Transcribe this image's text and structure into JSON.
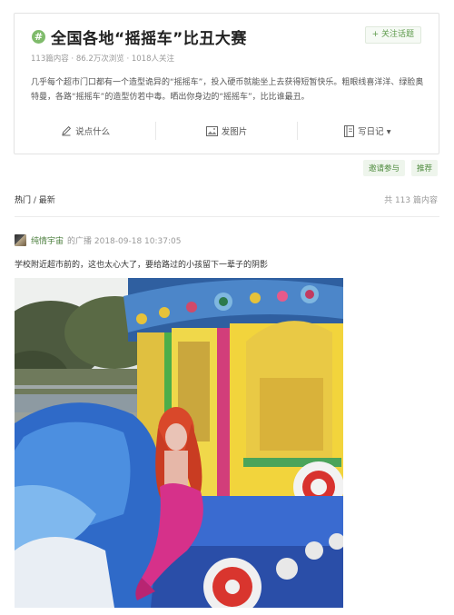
{
  "topic": {
    "hash_symbol": "#",
    "title": "全国各地“摇摇车”比丑大赛",
    "follow_label": "+ 关注话题",
    "stats": "113篇内容 · 86.2万次浏览 · 1018人关注",
    "description": "几乎每个超市门口都有一个造型诡异的“摇摇车”，投入硬币就能坐上去获得短暂快乐。粗眼线喜洋洋、绿脸奥特曼，各路“摇摇车”的造型仿若中毒。晒出你身边的“摇摇车”，比比谁最丑。"
  },
  "actions": [
    {
      "label": "说点什么",
      "icon": "pencil-icon"
    },
    {
      "label": "发图片",
      "icon": "image-icon"
    },
    {
      "label": "写日记 ▾",
      "icon": "notebook-icon"
    }
  ],
  "tags": [
    "邀请参与",
    "推荐"
  ],
  "filter": {
    "hot": "热门",
    "separator": " / ",
    "latest": "最新",
    "count": "共 113 篇内容"
  },
  "post": {
    "author": "纯情宇宙",
    "broadcast": "的广播  2018-09-18 10:37:05",
    "text": "学校附近超市前的，这也太心大了，要给路过的小孩留下一辈子的阴影"
  },
  "colors": {
    "accent_green": "#7fbb6b",
    "link_green": "#4b7e3c",
    "tag_bg": "#eef5ec"
  }
}
